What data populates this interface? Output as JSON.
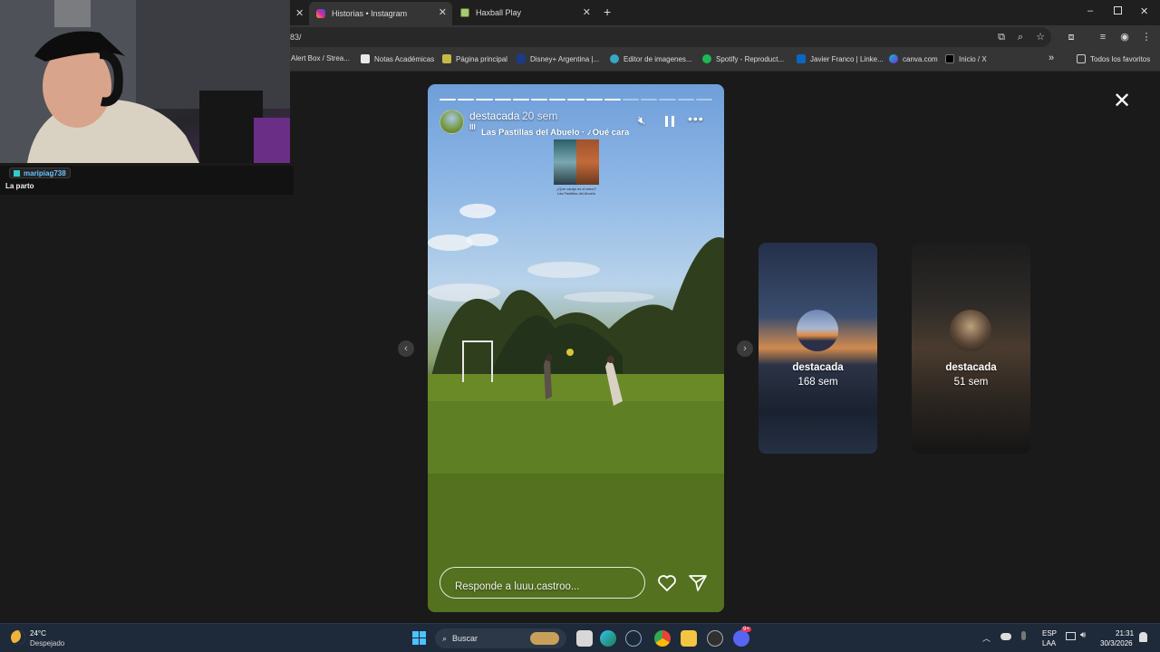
{
  "browser": {
    "tabs": [
      {
        "label": "Historias • Instagram",
        "active": true
      },
      {
        "label": "Haxball Play",
        "active": false
      }
    ],
    "new_tab_label": "+",
    "url": "83/",
    "bookmarks": [
      "Alert Box / Strea...",
      "Notas Académicas",
      "Página principal",
      "Disney+ Argentina |...",
      "Editor de imagenes...",
      "Spotify - Reproduct...",
      "Javier Franco | Linke...",
      "canva.com",
      "Inicio / X"
    ],
    "bookmarks_overflow": "»",
    "all_bookmarks_label": "Todos los favoritos"
  },
  "webcam": {
    "chat_user": "maripiag738",
    "chat_message": "La parto"
  },
  "story": {
    "username": "destacada",
    "time": "20 sem",
    "song": "Las Pastillas del Abuelo · ¿Qué carajo",
    "album_caption_1": "¿Qué carajo es el amor?",
    "album_caption_2": "Las Pastillas del Abuelo",
    "reply_placeholder": "Responde a luuu.castroo...",
    "progress_total": 15,
    "progress_done": 10,
    "close_label": "✕"
  },
  "side_stories": [
    {
      "label": "destacada",
      "time": "168 sem"
    },
    {
      "label": "destacada",
      "time": "51 sem"
    }
  ],
  "taskbar": {
    "weather_temp": "24°C",
    "weather_desc": "Despejado",
    "search_label": "Buscar",
    "lang_1": "ESP",
    "lang_2": "LAA",
    "time": "21:31",
    "date": "30/3/2026",
    "badge_count": "9+"
  },
  "colors": {
    "story_bg": "#1a1a1a",
    "chat_user": "#6cc3ff"
  }
}
